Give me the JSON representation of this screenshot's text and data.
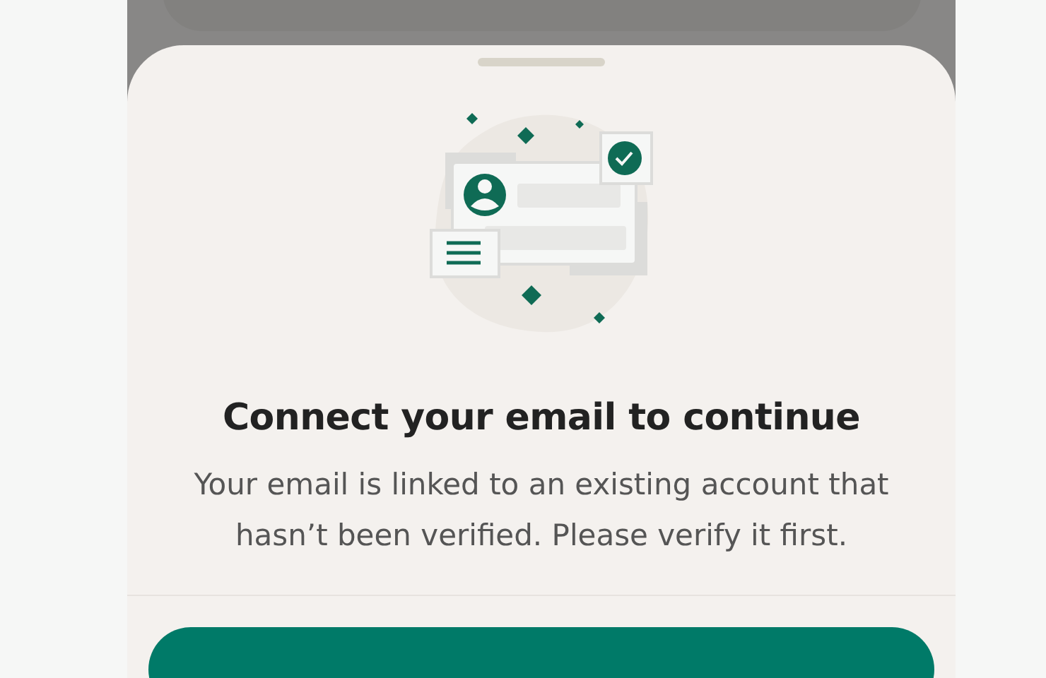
{
  "sheet": {
    "title": "Connect your email to continue",
    "message": "Your email is linked to an existing account that hasn’t been verified. Please verify it first."
  }
}
